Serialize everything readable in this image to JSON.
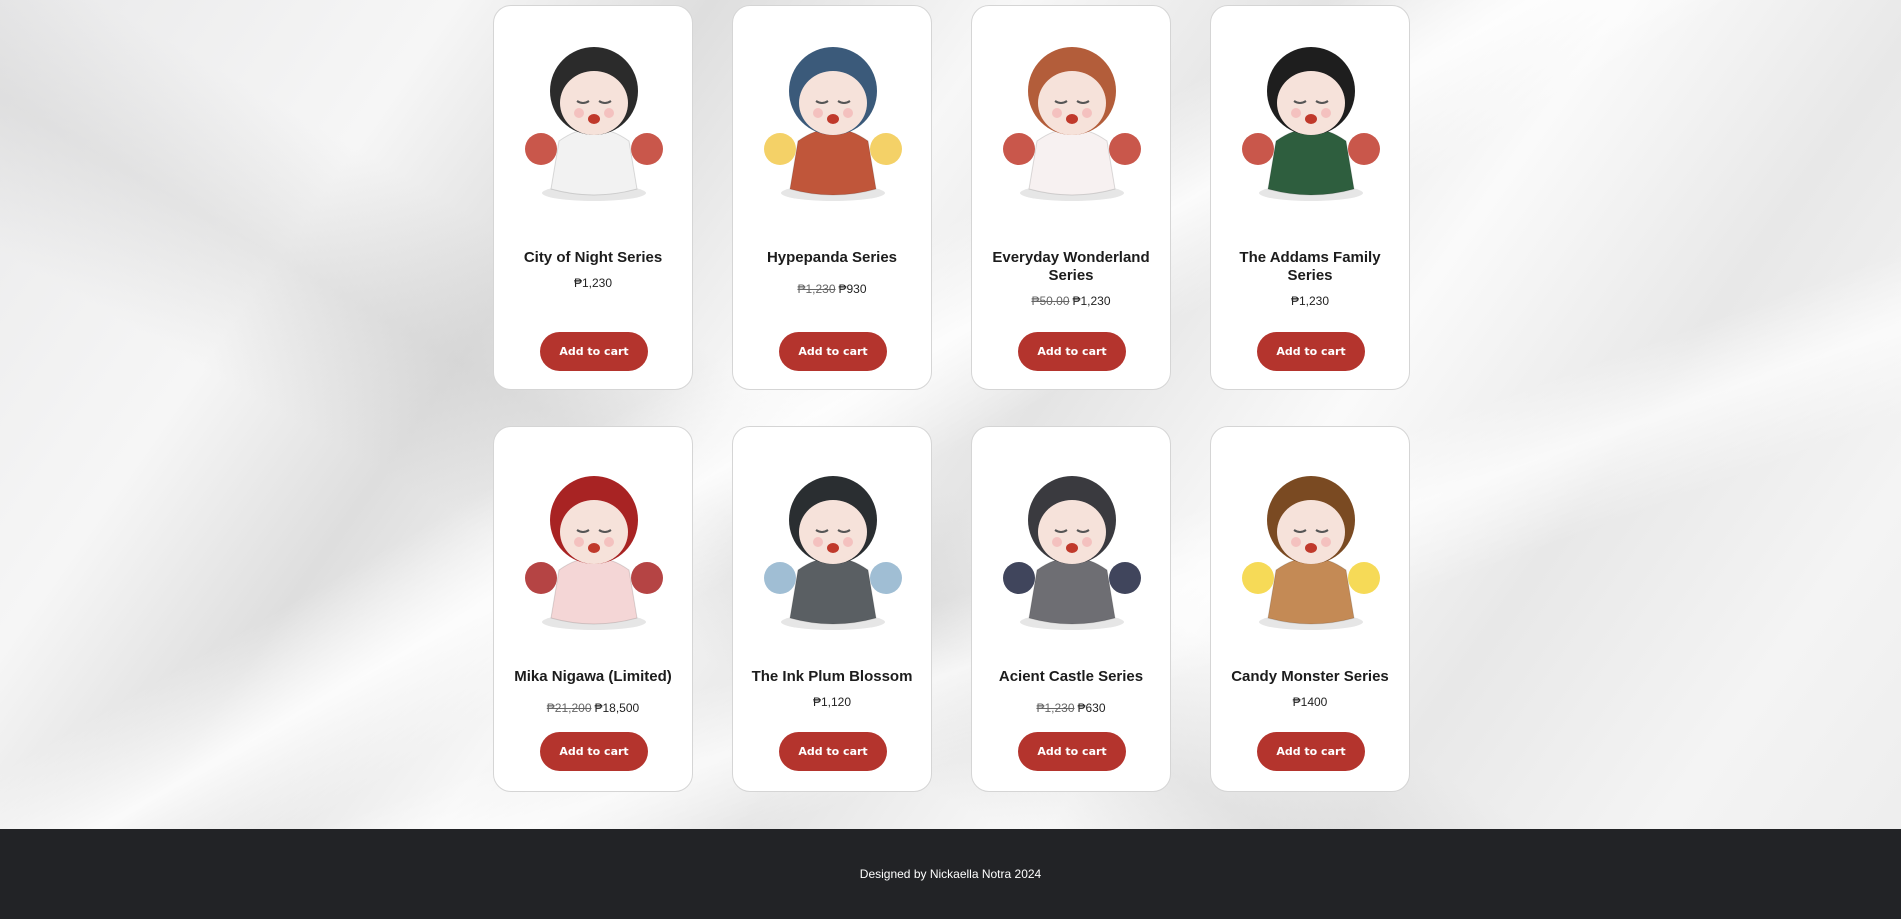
{
  "products": [
    {
      "name": "City of Night Series",
      "old_price": "",
      "price": "₱1,230",
      "price_line": 1,
      "button": "Add to cart",
      "palette": {
        "body": "#f2f2f2",
        "accent": "#c0392b",
        "hair": "#2b2b2b"
      }
    },
    {
      "name": "Hypepanda Series",
      "old_price": "₱1,230",
      "price": "₱930",
      "price_line": 1,
      "button": "Add to cart",
      "palette": {
        "body": "#c0563a",
        "accent": "#f2c94c",
        "hair": "#3b5a7a"
      }
    },
    {
      "name": "Everyday Wonderland Series",
      "old_price": "₱50.00",
      "price": "₱1,230",
      "price_line": 2,
      "button": "Add to cart",
      "palette": {
        "body": "#f7f1f1",
        "accent": "#c0392b",
        "hair": "#b35d3a"
      }
    },
    {
      "name": "The Addams Family Series",
      "old_price": "",
      "price": "₱1,230",
      "price_line": 2,
      "button": "Add to cart",
      "palette": {
        "body": "#2e5e3e",
        "accent": "#c0392b",
        "hair": "#1e1e1e"
      }
    },
    {
      "name": "Mika Nigawa (Limited)",
      "old_price": "₱21,200",
      "price": "₱18,500",
      "price_line": 1,
      "button": "Add to cart",
      "palette": {
        "body": "#f4d6d6",
        "accent": "#a82323",
        "hair": "#a82323"
      }
    },
    {
      "name": "The Ink Plum Blossom",
      "old_price": "",
      "price": "₱1,120",
      "price_line": 1,
      "button": "Add to cart",
      "palette": {
        "body": "#5a5f63",
        "accent": "#8fb3cc",
        "hair": "#2a2e31"
      }
    },
    {
      "name": "Acient Castle Series",
      "old_price": "₱1,230",
      "price": "₱630",
      "price_line": 1,
      "button": "Add to cart",
      "palette": {
        "body": "#6e6e73",
        "accent": "#1e2440",
        "hair": "#3a3a3f"
      }
    },
    {
      "name": "Candy Monster Series",
      "old_price": "",
      "price": "₱1400",
      "price_line": 1,
      "button": "Add to cart",
      "palette": {
        "body": "#c48a55",
        "accent": "#f5d33a",
        "hair": "#7a4a22"
      }
    }
  ],
  "footer": {
    "text": "Designed by Nickaella Notra 2024"
  }
}
